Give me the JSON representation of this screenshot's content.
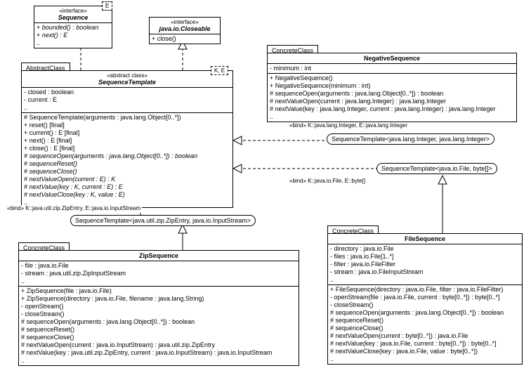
{
  "sequence": {
    "stereo": "«interface»",
    "name": "Sequence",
    "param": "E",
    "ops": [
      "+ bounded() : boolean",
      "+ next() : E",
      ".."
    ]
  },
  "closeable": {
    "stereo": "«interface»",
    "name": "java.io.Closeable",
    "ops": [
      "+ close()"
    ]
  },
  "abstractTag": "AbstractClass",
  "template": {
    "stereo": "«abstract class»",
    "name": "SequenceTemplate",
    "param": "K, E",
    "attrs": [
      "- closed : boolean",
      "- current : E",
      ".."
    ],
    "ops": [
      "# SequenceTemplate(arguments : java.lang.Object[0..*])",
      "+ reset()  [final]",
      "+ current() : E  [final]",
      "+ next() : E  [final]",
      "+ close() : E  [final]",
      "# sequenceOpen(arguments : java.lang.Object[0..*]) : boolean",
      "# sequenceReset()",
      "# sequenceClose()",
      "# nextValueOpen(current : E) : K",
      "# nextValue(key : K, current : E) : E",
      "# nextValueClose(key : K, value : E)",
      ".."
    ]
  },
  "negativeTag": "ConcreteClass",
  "negative": {
    "name": "NegativeSequence",
    "attrs": [
      "- minimum : int"
    ],
    "ops": [
      "+ NegativeSequence()",
      "+ NegativeSequence(minimum : int)",
      "# sequenceOpen(arguments : java.lang.Object[0..*]) : boolean",
      "# nextValueOpen(current : java.lang.Integer) : java.lang.Integer",
      "# nextValue(key : java.lang.Integer, current : java.lang.Integer) : java.lang.Integer",
      ".."
    ]
  },
  "bindNeg": "«bind» K::java.lang.Integer, E::java.lang.Integer",
  "paramNeg": "SequenceTemplate<java.lang.Integer, java.lang.Integer>",
  "bindFile": "«bind» K::java.io.File, E::byte[]",
  "paramFile": "SequenceTemplate<java.io.File, byte[]>",
  "bindZip": "«bind» K::java.util.zip.ZipEntry, E::java.io.InputStream",
  "paramZip": "SequenceTemplate<java.util.zip.ZipEntry, java.io.InputStream>",
  "zipTag": "ConcreteClass",
  "zip": {
    "name": "ZipSequence",
    "attrs": [
      "- file : java.io.File",
      "- stream : java.util.zip.ZipInputStream",
      ".."
    ],
    "ops": [
      "+ ZipSequence(file : java.io.File)",
      "+ ZipSequence(directory : java.io.File, filename : java.lang.String)",
      "- openStream()",
      "- closeStream()",
      "# sequenceOpen(arguments : java.lang.Object[0..*]) : boolean",
      "# sequenceReset()",
      "# sequenceClose()",
      "# nextValueOpen(current : java.io.InputStream) : java.util.zip.ZipEntry",
      "# nextValue(key : java.util.zip.ZipEntry, current : java.io.InputStream) : java.io.InputStream",
      ".."
    ]
  },
  "fileTag": "ConcreteClass",
  "file": {
    "name": "FileSequence",
    "attrs": [
      "- directory : java.io.File",
      "- files : java.io.File[1..*]",
      "- filter : java.io.FileFilter",
      "- stream : java.io.FileInputStream",
      ".."
    ],
    "ops": [
      "+ FileSequence(directory : java.io.File, filter : java.io.FileFilter)",
      "- openStream(file : java.io.File, current : byte[0..*]) : byte[0..*]",
      "- closeStream()",
      "# sequenceOpen(arguments : java.lang.Object[0..*]) : boolean",
      "# sequenceReset()",
      "# sequenceClose()",
      "# nextValueOpen(current : byte[0..*]) : java.io.File",
      "# nextValue(key : java.io.File, current : byte[0..*]) : byte[0..*]",
      "# nextValueClose(key : java.io.File, value : byte[0..*])",
      ".."
    ]
  }
}
